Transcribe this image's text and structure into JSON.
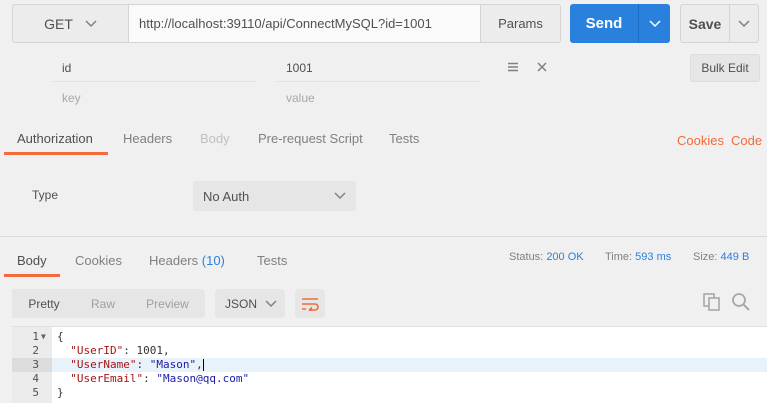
{
  "request": {
    "method": "GET",
    "url": "http://localhost:39110/api/ConnectMySQL?id=1001",
    "params_label": "Params",
    "send_label": "Send",
    "save_label": "Save"
  },
  "params": {
    "rows": [
      {
        "key": "id",
        "value": "1001"
      }
    ],
    "key_placeholder": "key",
    "value_placeholder": "value",
    "bulk_edit_label": "Bulk Edit"
  },
  "request_tabs": [
    {
      "label": "Authorization",
      "state": "active"
    },
    {
      "label": "Headers",
      "state": "normal"
    },
    {
      "label": "Body",
      "state": "disabled"
    },
    {
      "label": "Pre-request Script",
      "state": "normal"
    },
    {
      "label": "Tests",
      "state": "normal"
    }
  ],
  "links": {
    "cookies": "Cookies",
    "code": "Code"
  },
  "auth": {
    "type_label": "Type",
    "selected": "No Auth"
  },
  "response_tabs": {
    "body": "Body",
    "cookies": "Cookies",
    "headers": "Headers",
    "headers_count": "(10)",
    "tests": "Tests"
  },
  "status": {
    "status_label": "Status:",
    "status_value": "200 OK",
    "time_label": "Time:",
    "time_value": "593 ms",
    "size_label": "Size:",
    "size_value": "449 B"
  },
  "format": {
    "pretty": "Pretty",
    "raw": "Raw",
    "preview": "Preview",
    "language": "JSON"
  },
  "response_body": {
    "line_numbers": [
      "1",
      "2",
      "3",
      "4",
      "5"
    ],
    "open_brace": "{",
    "close_brace": "}",
    "fields": [
      {
        "key": "\"UserID\"",
        "value": "1001",
        "suffix": ","
      },
      {
        "key": "\"UserName\"",
        "value": "\"Mason\"",
        "suffix": ","
      },
      {
        "key": "\"UserEmail\"",
        "value": "\"Mason@qq.com\"",
        "suffix": ""
      }
    ]
  },
  "colors": {
    "accent_blue": "#2a81dd",
    "accent_orange": "#f26b3a"
  }
}
